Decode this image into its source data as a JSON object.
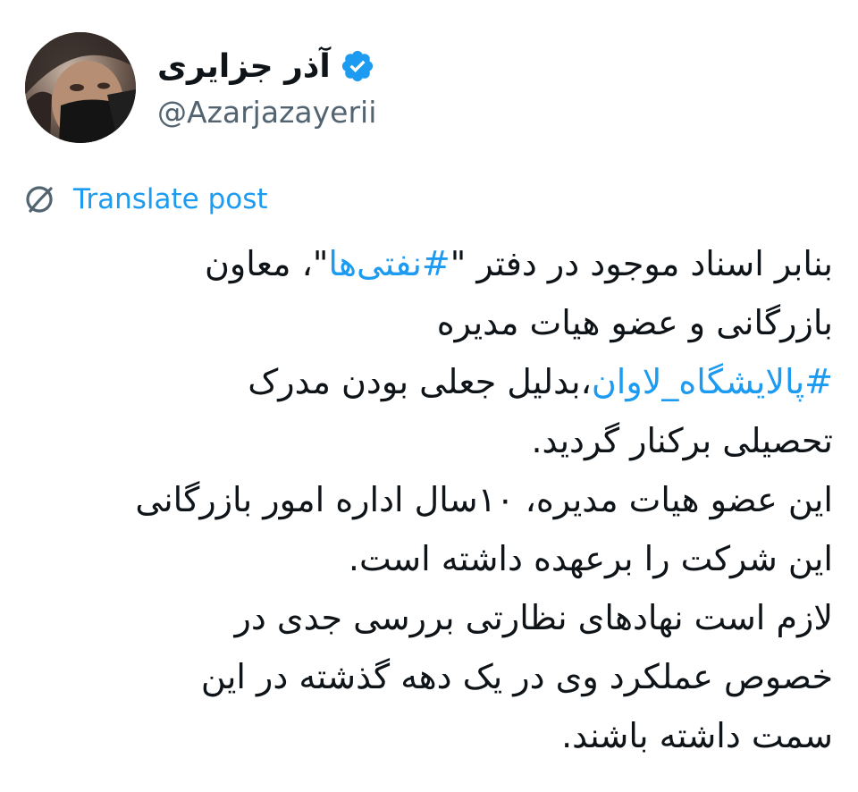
{
  "author": {
    "display_name": "آذر جزایری",
    "handle": "@Azarjazayerii",
    "verified": true
  },
  "translate": {
    "label": "Translate post"
  },
  "post": {
    "line1_prefix": "بنابر اسناد موجود در دفتر \"",
    "hashtag1": "#نفتی‌ها",
    "line1_suffix": "\"، معاون",
    "line2": "بازرگانی و عضو هیات مدیره",
    "hashtag2": "#پالایشگاه_لاوان",
    "line3_suffix": "،بدلیل جعلی بودن مدرک",
    "line4": "تحصیلی برکنار گردید.",
    "line5": "این عضو هیات مدیره، ۱۰سال اداره امور بازرگانی",
    "line6": "این شرکت را برعهده داشته است.",
    "line7": "لازم است نهادهای نظارتی بررسی جدی در",
    "line8": "خصوص عملکرد وی در یک دهه گذشته در این",
    "line9": "سمت داشته باشند."
  },
  "colors": {
    "link": "#1d9bf0",
    "text": "#0f1419",
    "secondary": "#536471",
    "verified_badge": "#1d9bf0"
  },
  "icons": {
    "verified": "verified-badge-icon",
    "translate": "translate-icon"
  }
}
